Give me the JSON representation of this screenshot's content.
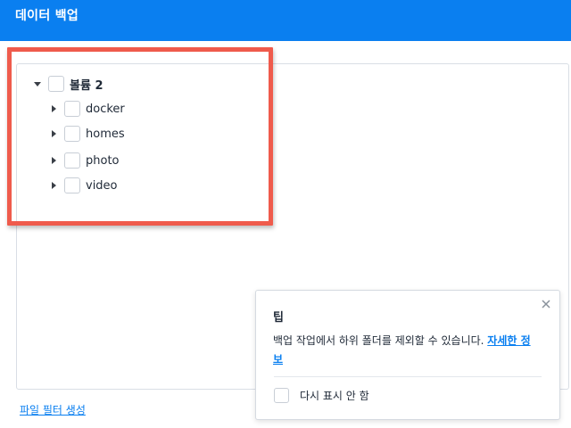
{
  "header": {
    "title": "데이터 백업"
  },
  "tree": {
    "root": {
      "label": "볼륨 2",
      "expanded": true,
      "checked": false
    },
    "children": [
      {
        "label": "docker",
        "expanded": false,
        "checked": false
      },
      {
        "label": "homes",
        "expanded": false,
        "checked": false
      },
      {
        "label": "photo",
        "expanded": false,
        "checked": false
      },
      {
        "label": "video",
        "expanded": false,
        "checked": false
      }
    ]
  },
  "footer": {
    "filter_link": "파일 필터 생성"
  },
  "tip": {
    "title": "팁",
    "body": "백업 작업에서 하위 폴더를 제외할 수 있습니다. ",
    "link": "자세한 정보",
    "dont_show_again": "다시 표시 안 함",
    "dont_show_checked": false
  },
  "colors": {
    "header_bg": "#0a7ff0",
    "highlight": "#ef5b4c",
    "link": "#0a7ff0"
  }
}
